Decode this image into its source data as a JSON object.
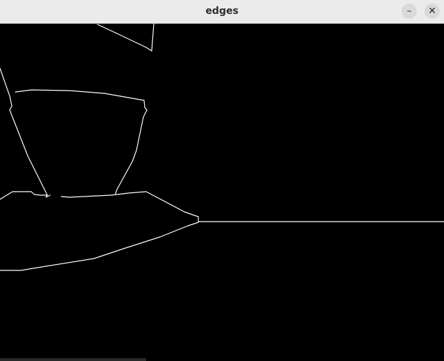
{
  "window": {
    "title": "edges",
    "minimize_glyph": "–",
    "close_glyph": "✕",
    "minimize_icon": "minimize-icon",
    "close_icon": "close-icon"
  },
  "image": {
    "background_color": "#000000",
    "edge_color": "#ffffff"
  }
}
